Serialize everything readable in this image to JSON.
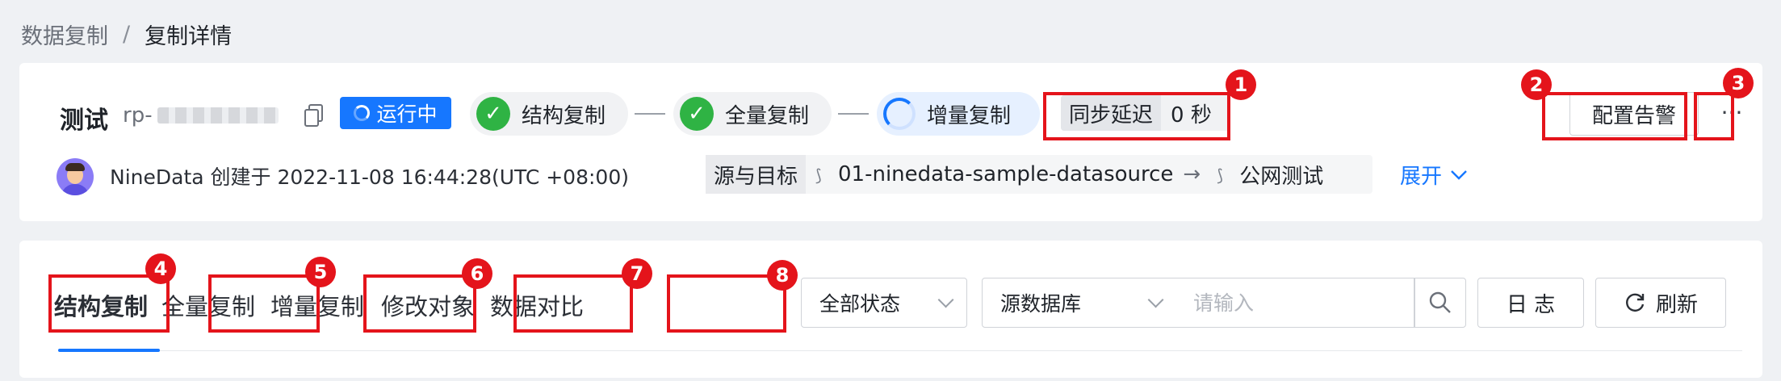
{
  "breadcrumb": {
    "parent": "数据复制",
    "separator": "/",
    "current": "复制详情"
  },
  "task": {
    "name": "测试",
    "id_prefix": "rp-",
    "status": "运行中",
    "steps": [
      "结构复制",
      "全量复制",
      "增量复制"
    ],
    "sync_delay_label": "同步延迟",
    "sync_delay_value": "0 秒",
    "alert_button": "配置告警",
    "more_button": "···",
    "creator_text": "NineData 创建于 2022-11-08 16:44:28(UTC +08:00)",
    "source_target_label": "源与目标",
    "source": "01-ninedata-sample-datasource",
    "arrow": "→",
    "target": "公网测试",
    "expand": "展开"
  },
  "tabs": [
    "结构复制",
    "全量复制",
    "增量复制",
    "修改对象",
    "数据对比"
  ],
  "filters": {
    "status_select": "全部状态",
    "db_select": "源数据库",
    "search_placeholder": "请输入",
    "log_button": "日 志",
    "refresh_button": "刷新"
  },
  "annotations": [
    "1",
    "2",
    "3",
    "4",
    "5",
    "6",
    "7",
    "8"
  ],
  "colors": {
    "accent": "#1677ff",
    "success": "#2fb344",
    "annotation": "#e4141b"
  }
}
